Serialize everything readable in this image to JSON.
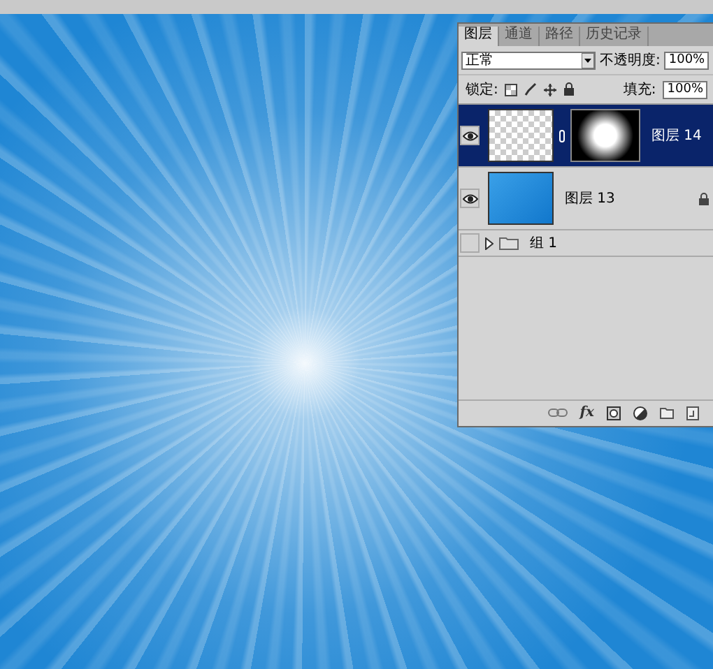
{
  "tabs": [
    {
      "label": "图层",
      "selected": true
    },
    {
      "label": "通道",
      "selected": false
    },
    {
      "label": "路径",
      "selected": false
    },
    {
      "label": "历史记录",
      "selected": false
    }
  ],
  "blend_mode": {
    "value": "正常"
  },
  "opacity": {
    "label": "不透明度:",
    "value": "100%"
  },
  "lock": {
    "label": "锁定:"
  },
  "fill": {
    "label": "填充:",
    "value": "100%"
  },
  "layers": [
    {
      "kind": "layer",
      "name": "图层 14",
      "visible": true,
      "selected": true,
      "has_mask": true,
      "locked": false
    },
    {
      "kind": "layer",
      "name": "图层 13",
      "visible": true,
      "selected": false,
      "has_mask": false,
      "locked": true
    },
    {
      "kind": "group",
      "name": "组 1",
      "visible": false,
      "selected": false
    }
  ],
  "footer": {
    "fx": "fx"
  }
}
